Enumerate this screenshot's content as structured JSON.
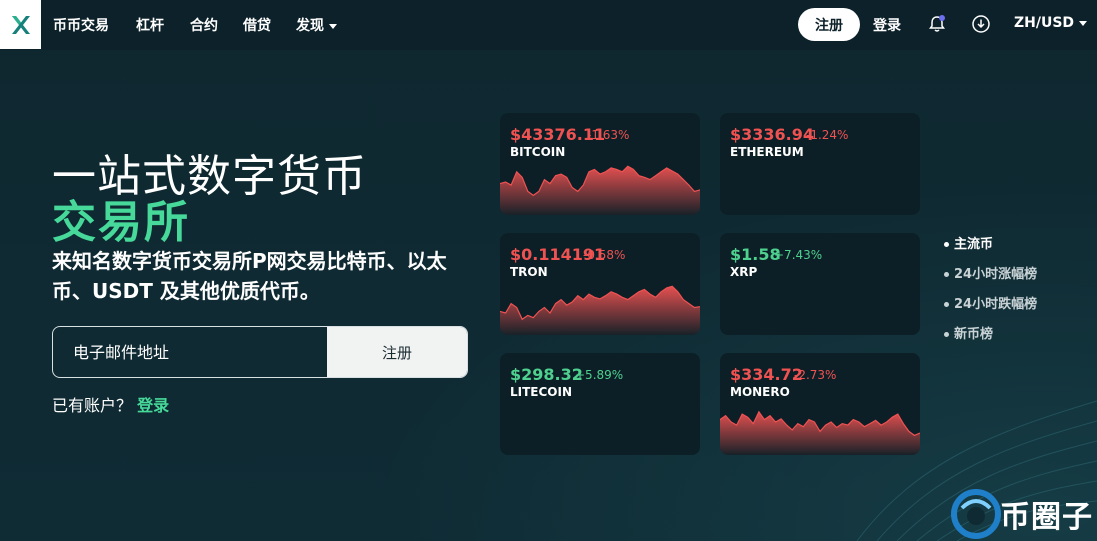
{
  "nav": {
    "items": [
      {
        "label": "币币交易"
      },
      {
        "label": "杠杆"
      },
      {
        "label": "合约"
      },
      {
        "label": "借贷"
      },
      {
        "label": "发现"
      }
    ],
    "register_label": "注册",
    "login_label": "登录",
    "locale_label": "ZH/USD"
  },
  "hero": {
    "title_line1": "一站式数字货币",
    "title_line2": "交易所",
    "description": "来知名数字货币交易所P网交易比特币、以太币、USDT 及其他优质代币。",
    "email_placeholder": "电子邮件地址",
    "email_value": "",
    "submit_label": "注册",
    "have_account": "已有账户？",
    "login_link": "登录"
  },
  "markets": [
    {
      "price": "$43376.11",
      "change": "-1.63%",
      "name": "BITCOIN",
      "trend": "down",
      "spark": [
        40,
        42,
        38,
        55,
        48,
        30,
        25,
        30,
        45,
        40,
        50,
        52,
        48,
        35,
        30,
        38,
        55,
        58,
        52,
        55,
        60,
        58,
        55,
        62,
        58,
        50,
        48,
        45,
        50,
        55,
        60,
        56,
        52,
        45,
        38,
        30,
        32
      ]
    },
    {
      "price": "$3336.94",
      "change": "-1.24%",
      "name": "ETHEREUM",
      "trend": "down",
      "spark": []
    },
    {
      "price": "$0.114191",
      "change": "-0.58%",
      "name": "TRON",
      "trend": "down",
      "spark": [
        30,
        28,
        40,
        35,
        20,
        25,
        22,
        30,
        35,
        28,
        40,
        45,
        38,
        42,
        50,
        45,
        52,
        48,
        46,
        50,
        55,
        52,
        48,
        45,
        50,
        55,
        58,
        52,
        48,
        55,
        60,
        62,
        55,
        45,
        40,
        35,
        36
      ]
    },
    {
      "price": "$1.58",
      "change": "+7.43%",
      "name": "XRP",
      "trend": "up",
      "spark": []
    },
    {
      "price": "$298.32",
      "change": "+5.89%",
      "name": "LITECOIN",
      "trend": "up",
      "spark": []
    },
    {
      "price": "$334.72",
      "change": "-2.73%",
      "name": "MONERO",
      "trend": "down",
      "spark": [
        45,
        50,
        42,
        38,
        52,
        48,
        40,
        55,
        45,
        50,
        42,
        46,
        38,
        32,
        40,
        36,
        45,
        42,
        30,
        38,
        42,
        35,
        40,
        38,
        45,
        42,
        36,
        40,
        44,
        38,
        42,
        48,
        52,
        40,
        30,
        25,
        28
      ]
    }
  ],
  "side_menu": [
    {
      "label": "主流币",
      "active": true
    },
    {
      "label": "24小时涨幅榜",
      "active": false
    },
    {
      "label": "24小时跌幅榜",
      "active": false
    },
    {
      "label": "新币榜",
      "active": false
    }
  ],
  "watermark": {
    "text": "币圈子"
  },
  "colors": {
    "accent_green": "#46d99a",
    "down_red": "#f05252",
    "up_green": "#4ed18f",
    "background": "#0f2a33"
  }
}
